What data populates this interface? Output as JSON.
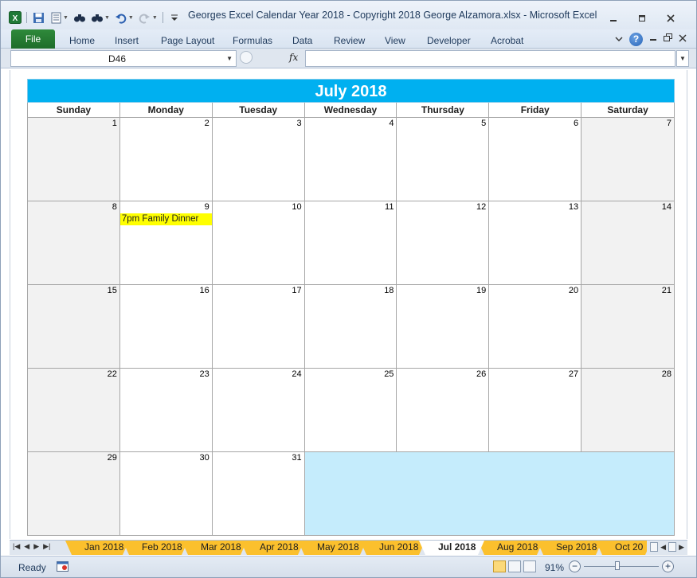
{
  "window": {
    "title": "Georges Excel Calendar Year 2018  -  Copyright 2018 George Alzamora.xlsx  -  Microsoft Excel"
  },
  "ribbon": {
    "tabs": [
      "File",
      "Home",
      "Insert",
      "Page Layout",
      "Formulas",
      "Data",
      "Review",
      "View",
      "Developer",
      "Acrobat"
    ]
  },
  "formula_bar": {
    "name_box": "D46",
    "fx_label": "fx",
    "formula": ""
  },
  "calendar": {
    "title": "July 2018",
    "days_of_week": [
      "Sunday",
      "Monday",
      "Tuesday",
      "Wednesday",
      "Thursday",
      "Friday",
      "Saturday"
    ],
    "weeks": [
      [
        "1",
        "2",
        "3",
        "4",
        "5",
        "6",
        "7"
      ],
      [
        "8",
        "9",
        "10",
        "11",
        "12",
        "13",
        "14"
      ],
      [
        "15",
        "16",
        "17",
        "18",
        "19",
        "20",
        "21"
      ],
      [
        "22",
        "23",
        "24",
        "25",
        "26",
        "27",
        "28"
      ],
      [
        "29",
        "30",
        "31"
      ]
    ],
    "events": [
      {
        "day": "9",
        "text": "7pm Family Dinner",
        "color": "#ffff00"
      }
    ],
    "colors": {
      "header": "#00b0f0",
      "weekend": "#f2f2f2",
      "blank": "#c5ecfc"
    }
  },
  "sheet_tabs": {
    "tabs": [
      "Jan 2018",
      "Feb 2018",
      "Mar 2018",
      "Apr 2018",
      "May 2018",
      "Jun 2018",
      "Jul 2018",
      "Aug 2018",
      "Sep 2018",
      "Oct 20"
    ],
    "active": "Jul 2018",
    "tab_color": "#fbc02d"
  },
  "status_bar": {
    "status": "Ready",
    "zoom": "91%",
    "zoom_fraction": 0.91
  }
}
